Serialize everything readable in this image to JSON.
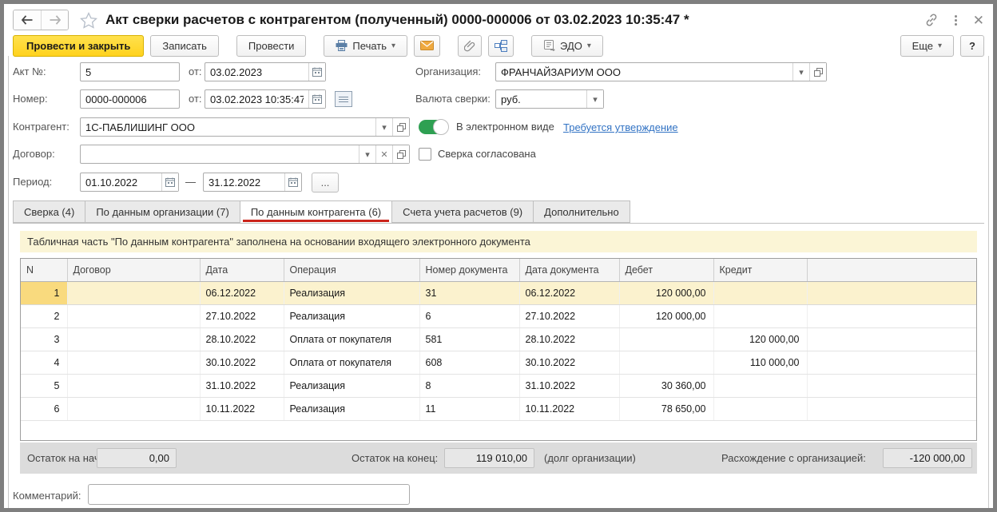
{
  "window": {
    "title": "Акт сверки расчетов с контрагентом (полученный) 0000-000006 от 03.02.2023 10:35:47 *"
  },
  "toolbar": {
    "post_and_close": "Провести и закрыть",
    "save": "Записать",
    "post": "Провести",
    "print": "Печать",
    "edo": "ЭДО",
    "more": "Еще",
    "help": "?"
  },
  "fields": {
    "act_no_label": "Акт №:",
    "act_no": "5",
    "act_from_label": "от:",
    "act_date": "03.02.2023",
    "number_label": "Номер:",
    "number": "0000-000006",
    "number_from_label": "от:",
    "number_date": "03.02.2023 10:35:47",
    "organization_label": "Организация:",
    "organization": "ФРАНЧАЙЗАРИУМ ООО",
    "currency_label": "Валюта сверки:",
    "currency": "руб.",
    "contractor_label": "Контрагент:",
    "contractor": "1С-ПАБЛИШИНГ ООО",
    "electronic_label": "В электронном виде",
    "approval_link": "Требуется утверждение",
    "contract_label": "Договор:",
    "contract": "",
    "agreed_label": "Сверка согласована",
    "period_label": "Период:",
    "period_from": "01.10.2022",
    "period_dash": "—",
    "period_to": "31.12.2022",
    "period_more": "..."
  },
  "tabs": [
    {
      "label": "Сверка (4)",
      "active": false
    },
    {
      "label": "По данным организации (7)",
      "active": false
    },
    {
      "label": "По данным контрагента (6)",
      "active": true
    },
    {
      "label": "Счета учета расчетов (9)",
      "active": false
    },
    {
      "label": "Дополнительно",
      "active": false
    }
  ],
  "banner": "Табличная часть \"По данным контрагента\" заполнена на основании входящего электронного документа",
  "table": {
    "headers": [
      "N",
      "Договор",
      "Дата",
      "Операция",
      "Номер документа",
      "Дата документа",
      "Дебет",
      "Кредит",
      ""
    ],
    "rows": [
      {
        "n": "1",
        "contract": "",
        "date": "06.12.2022",
        "operation": "Реализация",
        "doc_no": "31",
        "doc_date": "06.12.2022",
        "debit": "120 000,00",
        "credit": ""
      },
      {
        "n": "2",
        "contract": "",
        "date": "27.10.2022",
        "operation": "Реализация",
        "doc_no": "6",
        "doc_date": "27.10.2022",
        "debit": "120 000,00",
        "credit": ""
      },
      {
        "n": "3",
        "contract": "",
        "date": "28.10.2022",
        "operation": "Оплата от покупателя",
        "doc_no": "581",
        "doc_date": "28.10.2022",
        "debit": "",
        "credit": "120 000,00"
      },
      {
        "n": "4",
        "contract": "",
        "date": "30.10.2022",
        "operation": "Оплата от покупателя",
        "doc_no": "608",
        "doc_date": "30.10.2022",
        "debit": "",
        "credit": "110 000,00"
      },
      {
        "n": "5",
        "contract": "",
        "date": "31.10.2022",
        "operation": "Реализация",
        "doc_no": "8",
        "doc_date": "31.10.2022",
        "debit": "30 360,00",
        "credit": ""
      },
      {
        "n": "6",
        "contract": "",
        "date": "10.11.2022",
        "operation": "Реализация",
        "doc_no": "11",
        "doc_date": "10.11.2022",
        "debit": "78 650,00",
        "credit": ""
      }
    ]
  },
  "totals": {
    "opening_label": "Остаток на начало:",
    "opening": "0,00",
    "closing_label": "Остаток на конец:",
    "closing": "119 010,00",
    "closing_note": "(долг организации)",
    "difference_label": "Расхождение с организацией:",
    "difference": "-120 000,00"
  },
  "comment": {
    "label": "Комментарий:",
    "value": ""
  },
  "icons": {
    "back-icon": "left arrow",
    "forward-icon": "right arrow",
    "star-icon": "favorite star outline",
    "link-icon": "chain link",
    "kebab-icon": "vertical dots menu",
    "close-icon": "×",
    "printer-icon": "printer",
    "mail-icon": "orange envelope",
    "paperclip-icon": "paperclip",
    "structure-icon": "related documents",
    "edo-icon": "electronic document",
    "calendar-icon": "calendar",
    "history-icon": "history list",
    "dropdown-icon": "▾",
    "open-icon": "open in window"
  },
  "colors": {
    "primary_button": "#ffd21e",
    "active_tab_underline": "#cb241b",
    "toggle_on": "#2ea052",
    "link": "#3273c4",
    "selected_row_bg": "#fbf2ce",
    "selected_row_num_bg": "#f9da7e",
    "banner_bg": "#fbf5d6",
    "totals_bg": "#dcdcdc",
    "window_frame": "#7f7f7f"
  }
}
